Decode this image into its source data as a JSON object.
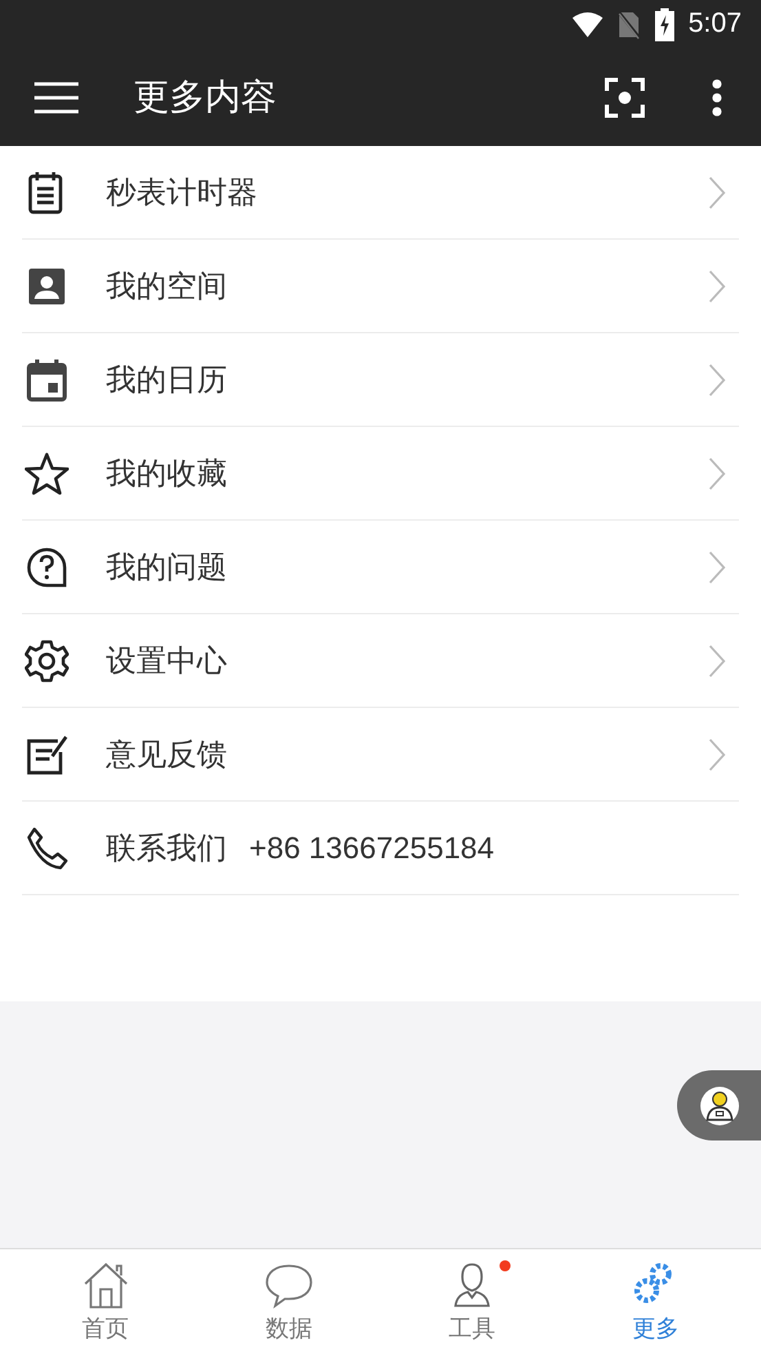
{
  "status_bar": {
    "time": "5:07"
  },
  "toolbar": {
    "title": "更多内容"
  },
  "menu": [
    {
      "kind": "link",
      "label": "秒表计时器"
    },
    {
      "kind": "link",
      "label": "我的空间"
    },
    {
      "kind": "link",
      "label": "我的日历"
    },
    {
      "kind": "link",
      "label": "我的收藏"
    },
    {
      "kind": "link",
      "label": "我的问题"
    },
    {
      "kind": "link",
      "label": "设置中心"
    },
    {
      "kind": "link",
      "label": "意见反馈"
    },
    {
      "kind": "contact",
      "label": "联系我们",
      "phone": "+86 13667255184"
    }
  ],
  "bottom_nav": [
    {
      "label": "首页",
      "selected": false,
      "badge": false
    },
    {
      "label": "数据",
      "selected": false,
      "badge": false
    },
    {
      "label": "工具",
      "selected": false,
      "badge": true
    },
    {
      "label": "更多",
      "selected": true,
      "badge": false
    }
  ]
}
